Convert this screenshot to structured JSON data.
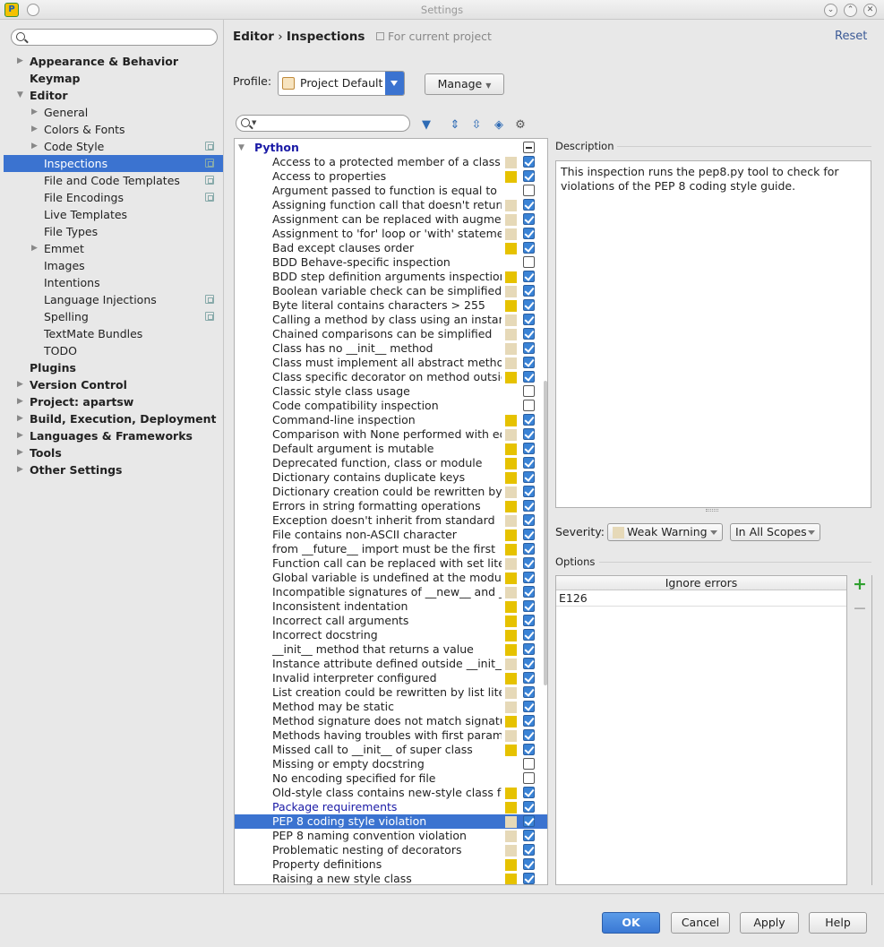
{
  "window": {
    "title": "Settings"
  },
  "colors": {
    "accent": "#3b73d0",
    "weak_warning": "#e6d9b8",
    "warning": "#e6c200",
    "error": "#ff6b6b",
    "add_green": "#2fa02f"
  },
  "sidebar": {
    "search_placeholder": "",
    "items": [
      {
        "label": "Appearance & Behavior",
        "bold": true,
        "arrow": "▶",
        "indent": 0
      },
      {
        "label": "Keymap",
        "bold": true,
        "arrow": "",
        "indent": 0
      },
      {
        "label": "Editor",
        "bold": true,
        "arrow": "▼",
        "indent": 0
      },
      {
        "label": "General",
        "bold": false,
        "arrow": "▶",
        "indent": 1
      },
      {
        "label": "Colors & Fonts",
        "bold": false,
        "arrow": "▶",
        "indent": 1
      },
      {
        "label": "Code Style",
        "bold": false,
        "arrow": "▶",
        "indent": 1,
        "project_icon": true
      },
      {
        "label": "Inspections",
        "bold": false,
        "arrow": "",
        "indent": 1,
        "project_icon": true,
        "selected": true
      },
      {
        "label": "File and Code Templates",
        "bold": false,
        "arrow": "",
        "indent": 1,
        "project_icon": true
      },
      {
        "label": "File Encodings",
        "bold": false,
        "arrow": "",
        "indent": 1,
        "project_icon": true
      },
      {
        "label": "Live Templates",
        "bold": false,
        "arrow": "",
        "indent": 1
      },
      {
        "label": "File Types",
        "bold": false,
        "arrow": "",
        "indent": 1
      },
      {
        "label": "Emmet",
        "bold": false,
        "arrow": "▶",
        "indent": 1
      },
      {
        "label": "Images",
        "bold": false,
        "arrow": "",
        "indent": 1
      },
      {
        "label": "Intentions",
        "bold": false,
        "arrow": "",
        "indent": 1
      },
      {
        "label": "Language Injections",
        "bold": false,
        "arrow": "",
        "indent": 1,
        "project_icon": true
      },
      {
        "label": "Spelling",
        "bold": false,
        "arrow": "",
        "indent": 1,
        "project_icon": true
      },
      {
        "label": "TextMate Bundles",
        "bold": false,
        "arrow": "",
        "indent": 1
      },
      {
        "label": "TODO",
        "bold": false,
        "arrow": "",
        "indent": 1
      },
      {
        "label": "Plugins",
        "bold": true,
        "arrow": "",
        "indent": 0
      },
      {
        "label": "Version Control",
        "bold": true,
        "arrow": "▶",
        "indent": 0
      },
      {
        "label": "Project: apartsw",
        "bold": true,
        "arrow": "▶",
        "indent": 0
      },
      {
        "label": "Build, Execution, Deployment",
        "bold": true,
        "arrow": "▶",
        "indent": 0
      },
      {
        "label": "Languages & Frameworks",
        "bold": true,
        "arrow": "▶",
        "indent": 0
      },
      {
        "label": "Tools",
        "bold": true,
        "arrow": "▶",
        "indent": 0
      },
      {
        "label": "Other Settings",
        "bold": true,
        "arrow": "▶",
        "indent": 0
      }
    ]
  },
  "header": {
    "breadcrumb_parent": "Editor",
    "breadcrumb_sep": "›",
    "breadcrumb_current": "Inspections",
    "scope_note": "For current project",
    "reset_label": "Reset"
  },
  "profile": {
    "label": "Profile:",
    "value": "Project Default",
    "manage_label": "Manage"
  },
  "inspections": {
    "group": "Python",
    "items": [
      {
        "name": "Access to a protected member of a class",
        "sev": "weak",
        "on": true
      },
      {
        "name": "Access to properties",
        "sev": "warn",
        "on": true
      },
      {
        "name": "Argument passed to function is equal to",
        "sev": "",
        "on": false
      },
      {
        "name": "Assigning function call that doesn't return",
        "sev": "weak",
        "on": true
      },
      {
        "name": "Assignment can be replaced with augmented",
        "sev": "weak",
        "on": true
      },
      {
        "name": "Assignment to 'for' loop or 'with' statement",
        "sev": "weak",
        "on": true
      },
      {
        "name": "Bad except clauses order",
        "sev": "warn",
        "on": true
      },
      {
        "name": "BDD Behave-specific inspection",
        "sev": "",
        "on": false
      },
      {
        "name": "BDD step definition arguments inspection",
        "sev": "warn",
        "on": true
      },
      {
        "name": "Boolean variable check can be simplified",
        "sev": "weak",
        "on": true
      },
      {
        "name": "Byte literal contains characters > 255",
        "sev": "warn",
        "on": true
      },
      {
        "name": "Calling a method by class using an instance",
        "sev": "weak",
        "on": true
      },
      {
        "name": "Chained comparisons can be simplified",
        "sev": "weak",
        "on": true
      },
      {
        "name": "Class has no __init__ method",
        "sev": "weak",
        "on": true
      },
      {
        "name": "Class must implement all abstract methods",
        "sev": "weak",
        "on": true
      },
      {
        "name": "Class specific decorator on method outside",
        "sev": "warn",
        "on": true
      },
      {
        "name": "Classic style class usage",
        "sev": "",
        "on": false
      },
      {
        "name": "Code compatibility inspection",
        "sev": "",
        "on": false
      },
      {
        "name": "Command-line inspection",
        "sev": "warn",
        "on": true
      },
      {
        "name": "Comparison with None performed with equality",
        "sev": "weak",
        "on": true
      },
      {
        "name": "Default argument is mutable",
        "sev": "warn",
        "on": true
      },
      {
        "name": "Deprecated function, class or module",
        "sev": "warn",
        "on": true
      },
      {
        "name": "Dictionary contains duplicate keys",
        "sev": "warn",
        "on": true
      },
      {
        "name": "Dictionary creation could be rewritten by",
        "sev": "weak",
        "on": true
      },
      {
        "name": "Errors in string formatting operations",
        "sev": "warn",
        "on": true
      },
      {
        "name": "Exception doesn't inherit from standard",
        "sev": "weak",
        "on": true
      },
      {
        "name": "File contains non-ASCII character",
        "sev": "warn",
        "on": true
      },
      {
        "name": "from __future__ import must be the first",
        "sev": "warn",
        "on": true
      },
      {
        "name": "Function call can be replaced with set literal",
        "sev": "weak",
        "on": true
      },
      {
        "name": "Global variable is undefined at the module",
        "sev": "warn",
        "on": true
      },
      {
        "name": "Incompatible signatures of __new__ and __init__",
        "sev": "weak",
        "on": true
      },
      {
        "name": "Inconsistent indentation",
        "sev": "warn",
        "on": true
      },
      {
        "name": "Incorrect call arguments",
        "sev": "warn",
        "on": true
      },
      {
        "name": "Incorrect docstring",
        "sev": "warn",
        "on": true
      },
      {
        "name": "__init__ method that returns a value",
        "sev": "warn",
        "on": true
      },
      {
        "name": "Instance attribute defined outside __init__",
        "sev": "weak",
        "on": true
      },
      {
        "name": "Invalid interpreter configured",
        "sev": "warn",
        "on": true
      },
      {
        "name": "List creation could be rewritten by list literal",
        "sev": "weak",
        "on": true
      },
      {
        "name": "Method may be static",
        "sev": "weak",
        "on": true
      },
      {
        "name": "Method signature does not match signature",
        "sev": "warn",
        "on": true
      },
      {
        "name": "Methods having troubles with first parameter",
        "sev": "weak",
        "on": true
      },
      {
        "name": "Missed call to __init__ of super class",
        "sev": "warn",
        "on": true
      },
      {
        "name": "Missing or empty docstring",
        "sev": "",
        "on": false
      },
      {
        "name": "No encoding specified for file",
        "sev": "",
        "on": false
      },
      {
        "name": "Old-style class contains new-style class features",
        "sev": "warn",
        "on": true
      },
      {
        "name": "Package requirements",
        "sev": "warn",
        "on": true,
        "modified": true
      },
      {
        "name": "PEP 8 coding style violation",
        "sev": "weak",
        "on": true,
        "selected": true
      },
      {
        "name": "PEP 8 naming convention violation",
        "sev": "weak",
        "on": true
      },
      {
        "name": "Problematic nesting of decorators",
        "sev": "weak",
        "on": true
      },
      {
        "name": "Property definitions",
        "sev": "warn",
        "on": true
      },
      {
        "name": "Raising a new style class",
        "sev": "warn",
        "on": true
      }
    ]
  },
  "description": {
    "label": "Description",
    "text": "This inspection runs the pep8.py tool to check for violations of the PEP 8 coding style guide."
  },
  "severity": {
    "label": "Severity:",
    "value": "Weak Warning",
    "scope": "In All Scopes"
  },
  "options": {
    "label": "Options",
    "table_header": "Ignore errors",
    "rows": [
      "E126"
    ]
  },
  "buttons": {
    "ok": "OK",
    "cancel": "Cancel",
    "apply": "Apply",
    "help": "Help"
  }
}
